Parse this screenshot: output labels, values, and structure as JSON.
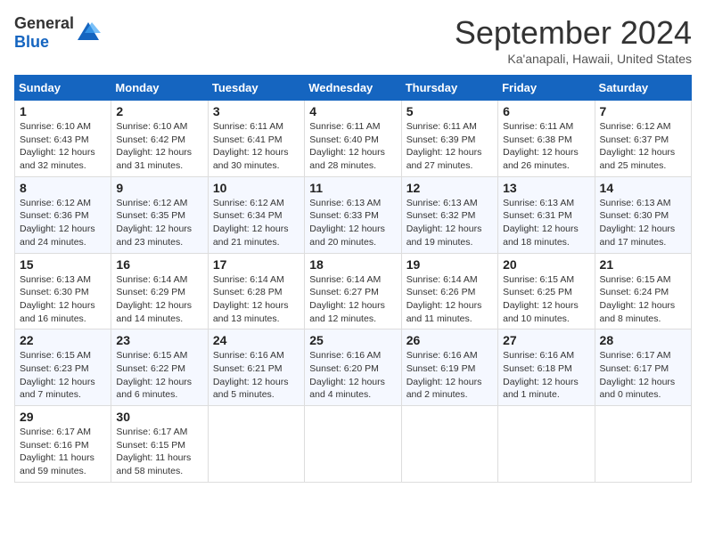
{
  "header": {
    "logo_general": "General",
    "logo_blue": "Blue",
    "month_title": "September 2024",
    "location": "Ka'anapali, Hawaii, United States"
  },
  "weekdays": [
    "Sunday",
    "Monday",
    "Tuesday",
    "Wednesday",
    "Thursday",
    "Friday",
    "Saturday"
  ],
  "weeks": [
    [
      {
        "day": "1",
        "info": "Sunrise: 6:10 AM\nSunset: 6:43 PM\nDaylight: 12 hours\nand 32 minutes."
      },
      {
        "day": "2",
        "info": "Sunrise: 6:10 AM\nSunset: 6:42 PM\nDaylight: 12 hours\nand 31 minutes."
      },
      {
        "day": "3",
        "info": "Sunrise: 6:11 AM\nSunset: 6:41 PM\nDaylight: 12 hours\nand 30 minutes."
      },
      {
        "day": "4",
        "info": "Sunrise: 6:11 AM\nSunset: 6:40 PM\nDaylight: 12 hours\nand 28 minutes."
      },
      {
        "day": "5",
        "info": "Sunrise: 6:11 AM\nSunset: 6:39 PM\nDaylight: 12 hours\nand 27 minutes."
      },
      {
        "day": "6",
        "info": "Sunrise: 6:11 AM\nSunset: 6:38 PM\nDaylight: 12 hours\nand 26 minutes."
      },
      {
        "day": "7",
        "info": "Sunrise: 6:12 AM\nSunset: 6:37 PM\nDaylight: 12 hours\nand 25 minutes."
      }
    ],
    [
      {
        "day": "8",
        "info": "Sunrise: 6:12 AM\nSunset: 6:36 PM\nDaylight: 12 hours\nand 24 minutes."
      },
      {
        "day": "9",
        "info": "Sunrise: 6:12 AM\nSunset: 6:35 PM\nDaylight: 12 hours\nand 23 minutes."
      },
      {
        "day": "10",
        "info": "Sunrise: 6:12 AM\nSunset: 6:34 PM\nDaylight: 12 hours\nand 21 minutes."
      },
      {
        "day": "11",
        "info": "Sunrise: 6:13 AM\nSunset: 6:33 PM\nDaylight: 12 hours\nand 20 minutes."
      },
      {
        "day": "12",
        "info": "Sunrise: 6:13 AM\nSunset: 6:32 PM\nDaylight: 12 hours\nand 19 minutes."
      },
      {
        "day": "13",
        "info": "Sunrise: 6:13 AM\nSunset: 6:31 PM\nDaylight: 12 hours\nand 18 minutes."
      },
      {
        "day": "14",
        "info": "Sunrise: 6:13 AM\nSunset: 6:30 PM\nDaylight: 12 hours\nand 17 minutes."
      }
    ],
    [
      {
        "day": "15",
        "info": "Sunrise: 6:13 AM\nSunset: 6:30 PM\nDaylight: 12 hours\nand 16 minutes."
      },
      {
        "day": "16",
        "info": "Sunrise: 6:14 AM\nSunset: 6:29 PM\nDaylight: 12 hours\nand 14 minutes."
      },
      {
        "day": "17",
        "info": "Sunrise: 6:14 AM\nSunset: 6:28 PM\nDaylight: 12 hours\nand 13 minutes."
      },
      {
        "day": "18",
        "info": "Sunrise: 6:14 AM\nSunset: 6:27 PM\nDaylight: 12 hours\nand 12 minutes."
      },
      {
        "day": "19",
        "info": "Sunrise: 6:14 AM\nSunset: 6:26 PM\nDaylight: 12 hours\nand 11 minutes."
      },
      {
        "day": "20",
        "info": "Sunrise: 6:15 AM\nSunset: 6:25 PM\nDaylight: 12 hours\nand 10 minutes."
      },
      {
        "day": "21",
        "info": "Sunrise: 6:15 AM\nSunset: 6:24 PM\nDaylight: 12 hours\nand 8 minutes."
      }
    ],
    [
      {
        "day": "22",
        "info": "Sunrise: 6:15 AM\nSunset: 6:23 PM\nDaylight: 12 hours\nand 7 minutes."
      },
      {
        "day": "23",
        "info": "Sunrise: 6:15 AM\nSunset: 6:22 PM\nDaylight: 12 hours\nand 6 minutes."
      },
      {
        "day": "24",
        "info": "Sunrise: 6:16 AM\nSunset: 6:21 PM\nDaylight: 12 hours\nand 5 minutes."
      },
      {
        "day": "25",
        "info": "Sunrise: 6:16 AM\nSunset: 6:20 PM\nDaylight: 12 hours\nand 4 minutes."
      },
      {
        "day": "26",
        "info": "Sunrise: 6:16 AM\nSunset: 6:19 PM\nDaylight: 12 hours\nand 2 minutes."
      },
      {
        "day": "27",
        "info": "Sunrise: 6:16 AM\nSunset: 6:18 PM\nDaylight: 12 hours\nand 1 minute."
      },
      {
        "day": "28",
        "info": "Sunrise: 6:17 AM\nSunset: 6:17 PM\nDaylight: 12 hours\nand 0 minutes."
      }
    ],
    [
      {
        "day": "29",
        "info": "Sunrise: 6:17 AM\nSunset: 6:16 PM\nDaylight: 11 hours\nand 59 minutes."
      },
      {
        "day": "30",
        "info": "Sunrise: 6:17 AM\nSunset: 6:15 PM\nDaylight: 11 hours\nand 58 minutes."
      },
      {
        "day": "",
        "info": ""
      },
      {
        "day": "",
        "info": ""
      },
      {
        "day": "",
        "info": ""
      },
      {
        "day": "",
        "info": ""
      },
      {
        "day": "",
        "info": ""
      }
    ]
  ]
}
